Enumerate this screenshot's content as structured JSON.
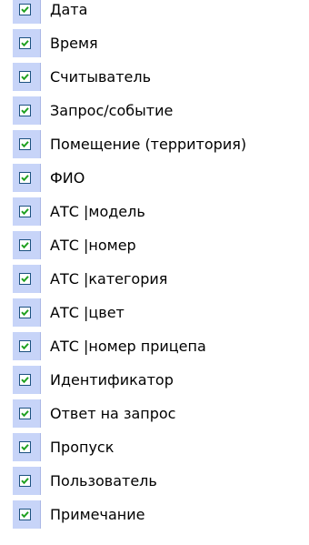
{
  "columns": {
    "items": [
      {
        "label": "Дата",
        "checked": true
      },
      {
        "label": "Время",
        "checked": true
      },
      {
        "label": "Считыватель",
        "checked": true
      },
      {
        "label": "Запрос/событие",
        "checked": true
      },
      {
        "label": "Помещение (территория)",
        "checked": true
      },
      {
        "label": "ФИО",
        "checked": true
      },
      {
        "label": "АТС |модель",
        "checked": true
      },
      {
        "label": "АТС |номер",
        "checked": true
      },
      {
        "label": "АТС |категория",
        "checked": true
      },
      {
        "label": "АТС |цвет",
        "checked": true
      },
      {
        "label": "АТС |номер прицепа",
        "checked": true
      },
      {
        "label": "Идентификатор",
        "checked": true
      },
      {
        "label": "Ответ на запрос",
        "checked": true
      },
      {
        "label": "Пропуск",
        "checked": true
      },
      {
        "label": "Пользователь",
        "checked": true
      },
      {
        "label": "Примечание",
        "checked": true
      }
    ]
  },
  "colors": {
    "check_column_bg": "#c7d4f8",
    "checkbox_border": "#1c5180",
    "checkmark": "#21a121"
  },
  "icons": {
    "check": "check-icon"
  }
}
